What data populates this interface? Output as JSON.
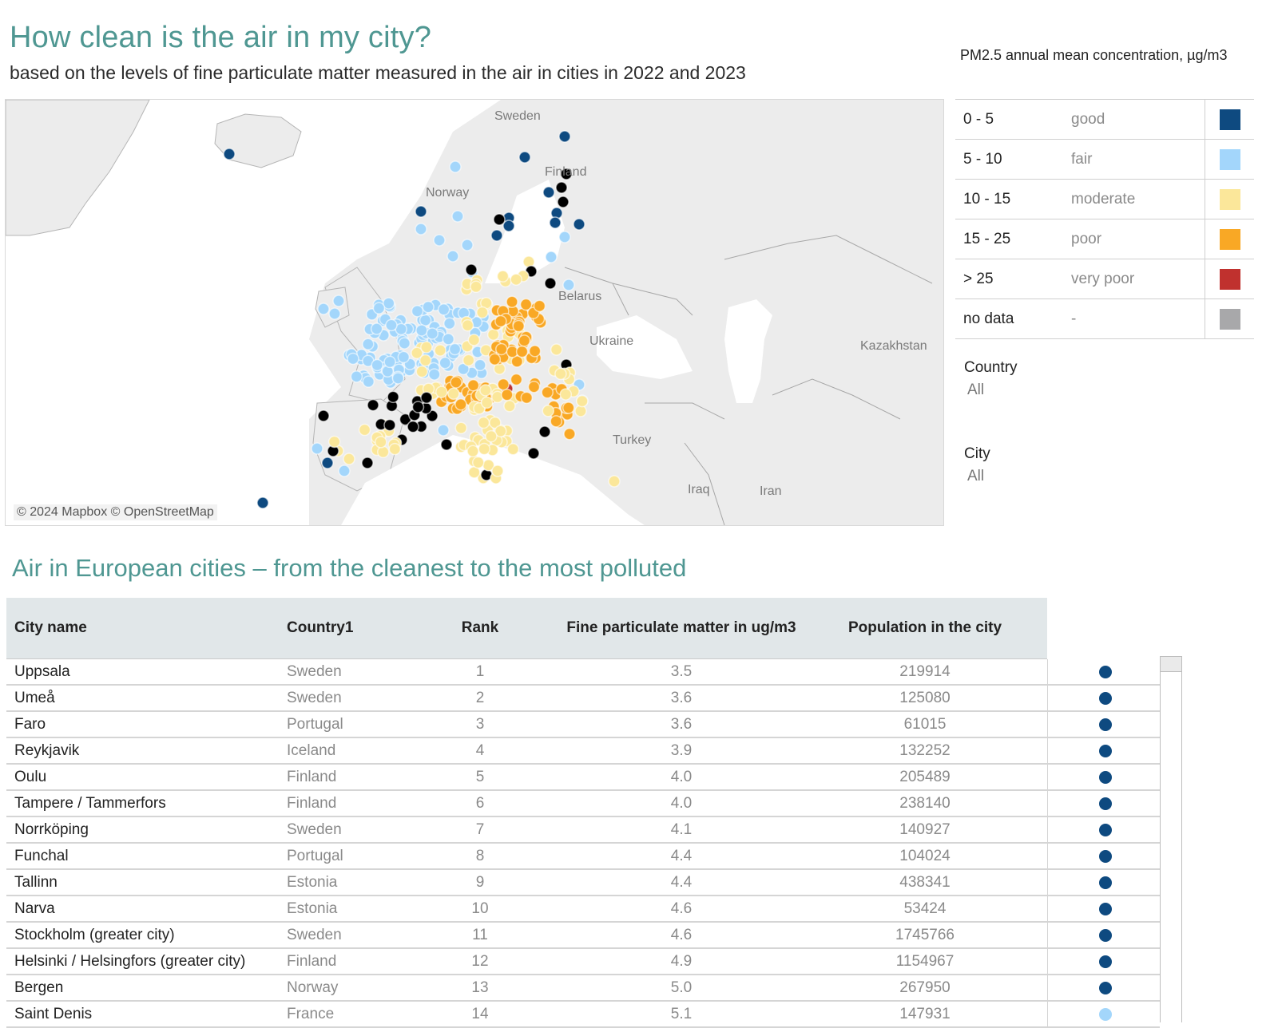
{
  "header": {
    "title": "How clean is the air in my city?",
    "subtitle": "based on the levels of fine particulate matter measured in the air in cities in 2022 and 2023"
  },
  "map": {
    "attribution": "© 2024 Mapbox © OpenStreetMap",
    "labels": [
      "Sweden",
      "Finland",
      "Norway",
      "Belarus",
      "Ukraine",
      "Kazakhstan",
      "Turkey",
      "Iraq",
      "Iran"
    ]
  },
  "legend": {
    "title": "PM2.5 annual mean concentration, µg/m3",
    "items": [
      {
        "range": "0 - 5",
        "label": "good",
        "color": "#0e4a80"
      },
      {
        "range": "5 - 10",
        "label": "fair",
        "color": "#a3d6fb"
      },
      {
        "range": "10 - 15",
        "label": "moderate",
        "color": "#fbe79a"
      },
      {
        "range": "15 - 25",
        "label": "poor",
        "color": "#f9a825"
      },
      {
        "range": "> 25",
        "label": "very poor",
        "color": "#c0312e"
      },
      {
        "range": "no data",
        "label": "-",
        "color": "#a8a8aa"
      }
    ]
  },
  "filters": {
    "country": {
      "label": "Country",
      "value": "All"
    },
    "city": {
      "label": "City",
      "value": "All"
    }
  },
  "table": {
    "title": "Air in European cities – from the cleanest to the most polluted",
    "columns": [
      "City name",
      "Country1",
      "Rank",
      "Fine particulate matter in ug/m3",
      "Population in the city"
    ],
    "rows": [
      {
        "city": "Uppsala",
        "country": "Sweden",
        "rank": "1",
        "pm": "3.5",
        "population": "219914",
        "category": "good"
      },
      {
        "city": "Umeå",
        "country": "Sweden",
        "rank": "2",
        "pm": "3.6",
        "population": "125080",
        "category": "good"
      },
      {
        "city": "Faro",
        "country": "Portugal",
        "rank": "3",
        "pm": "3.6",
        "population": "61015",
        "category": "good"
      },
      {
        "city": "Reykjavik",
        "country": "Iceland",
        "rank": "4",
        "pm": "3.9",
        "population": "132252",
        "category": "good"
      },
      {
        "city": "Oulu",
        "country": "Finland",
        "rank": "5",
        "pm": "4.0",
        "population": "205489",
        "category": "good"
      },
      {
        "city": "Tampere / Tammerfors",
        "country": "Finland",
        "rank": "6",
        "pm": "4.0",
        "population": "238140",
        "category": "good"
      },
      {
        "city": "Norrköping",
        "country": "Sweden",
        "rank": "7",
        "pm": "4.1",
        "population": "140927",
        "category": "good"
      },
      {
        "city": "Funchal",
        "country": "Portugal",
        "rank": "8",
        "pm": "4.4",
        "population": "104024",
        "category": "good"
      },
      {
        "city": "Tallinn",
        "country": "Estonia",
        "rank": "9",
        "pm": "4.4",
        "population": "438341",
        "category": "good"
      },
      {
        "city": "Narva",
        "country": "Estonia",
        "rank": "10",
        "pm": "4.6",
        "population": "53424",
        "category": "good"
      },
      {
        "city": "Stockholm (greater city)",
        "country": "Sweden",
        "rank": "11",
        "pm": "4.6",
        "population": "1745766",
        "category": "good"
      },
      {
        "city": "Helsinki / Helsingfors (greater city)",
        "country": "Finland",
        "rank": "12",
        "pm": "4.9",
        "population": "1154967",
        "category": "good"
      },
      {
        "city": "Bergen",
        "country": "Norway",
        "rank": "13",
        "pm": "5.0",
        "population": "267950",
        "category": "good"
      },
      {
        "city": "Saint Denis",
        "country": "France",
        "rank": "14",
        "pm": "5.1",
        "population": "147931",
        "category": "fair"
      }
    ]
  }
}
